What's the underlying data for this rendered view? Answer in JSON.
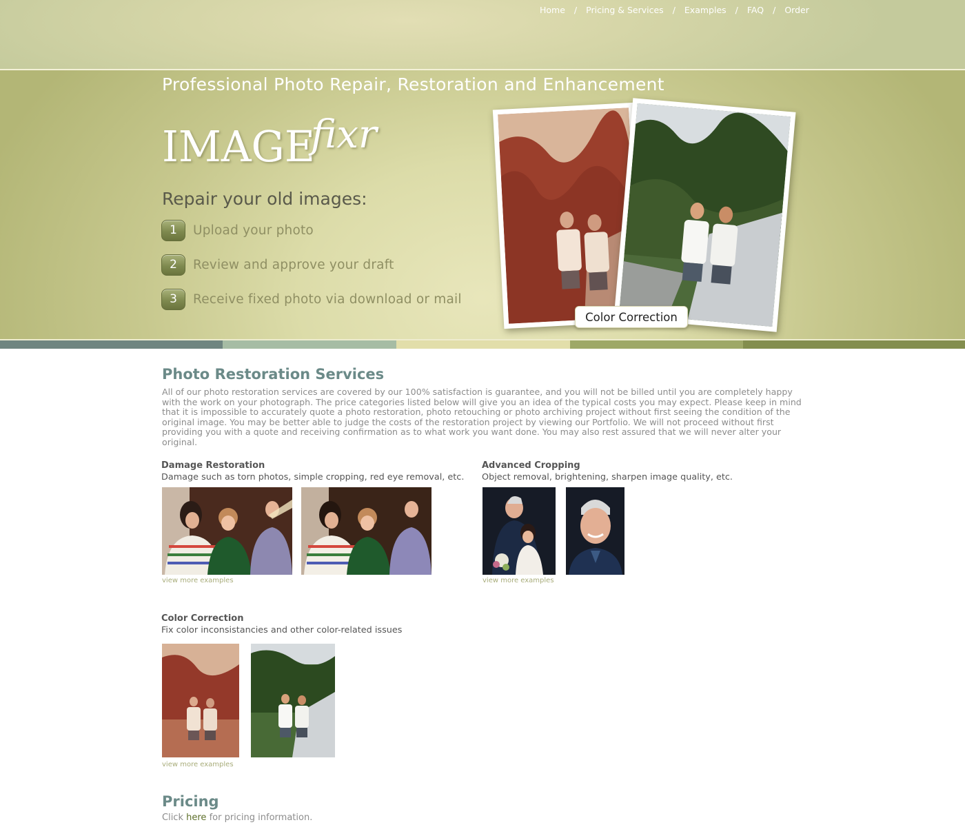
{
  "nav": {
    "items": [
      {
        "label": "Home"
      },
      {
        "label": "Pricing & Services"
      },
      {
        "label": "Examples"
      },
      {
        "label": "FAQ"
      },
      {
        "label": "Order"
      }
    ],
    "separator": "/"
  },
  "hero": {
    "tagline": "Professional Photo Repair, Restoration and Enhancement",
    "logo": {
      "part1": "IMAGE",
      "part2": "fixr"
    },
    "heading": "Repair your old images:",
    "steps": [
      {
        "number": "1",
        "text": "Upload your photo"
      },
      {
        "number": "2",
        "text": "Review and approve your draft"
      },
      {
        "number": "3",
        "text": "Receive fixed photo via download or mail"
      }
    ],
    "photo_caption": "Color Correction"
  },
  "color_bar": [
    "#6f8580",
    "#a6bca4",
    "#e2deaa",
    "#9ea867",
    "#838e4e"
  ],
  "services": {
    "title": "Photo Restoration Services",
    "intro": "All of our photo restoration services are covered by our 100% satisfaction is guarantee, and you will not be billed until you are completely happy with the work on your photograph. The price categories listed below will give you an idea of the typical costs you may expect. Please keep in mind that it is impossible to accurately quote a photo restoration, photo retouching or photo archiving project without first seeing the condition of the original image. You may be better able to judge the costs of the restoration project by viewing our Portfolio. We will not proceed without first providing you with a quote and receiving confirmation as to what work you want done. You may also rest assured that we will never alter your original.",
    "items": [
      {
        "title": "Damage Restoration",
        "desc": "Damage such as torn photos, simple cropping, red eye removal, etc.",
        "link": "view more examples"
      },
      {
        "title": "Advanced Cropping",
        "desc": "Object removal, brightening, sharpen image quality, etc.",
        "link": "view more examples"
      },
      {
        "title": "Color Correction",
        "desc": "Fix color inconsistancies and other color-related issues",
        "link": "view more examples"
      }
    ]
  },
  "pricing": {
    "title": "Pricing",
    "text_before": "Click",
    "link": "here",
    "text_after": "for pricing information."
  }
}
